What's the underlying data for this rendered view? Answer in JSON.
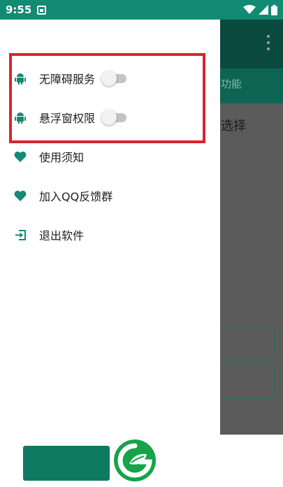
{
  "status_bar": {
    "time": "9:55"
  },
  "drawer": {
    "items": [
      {
        "label": "无障碍服务",
        "icon": "android-icon",
        "has_switch": true,
        "switch_on": false
      },
      {
        "label": "悬浮窗权限",
        "icon": "android-icon",
        "has_switch": true,
        "switch_on": false
      },
      {
        "label": "使用须知",
        "icon": "heart-icon"
      },
      {
        "label": "加入QQ反馈群",
        "icon": "heart-icon"
      },
      {
        "label": "退出软件",
        "icon": "exit-icon"
      }
    ]
  },
  "background_app": {
    "tab_partial": "功能",
    "text_partial_1": "选择",
    "text_partial_2": "̄"
  },
  "colors": {
    "accent": "#138a73",
    "toolbar_dim": "#0b4a3e",
    "highlight": "#d9242b",
    "bottom_button": "#0f7a62",
    "logo": "#16a34a"
  }
}
